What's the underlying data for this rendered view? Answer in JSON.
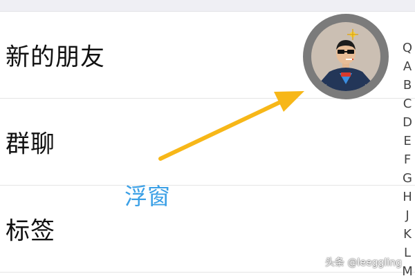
{
  "contacts_list": {
    "rows": [
      {
        "label": "新的朋友"
      },
      {
        "label": "群聊"
      },
      {
        "label": "标签"
      }
    ]
  },
  "floating_window": {
    "annotation": "浮窗",
    "avatar_icon": "cartoon-man-avatar-icon",
    "ring_color": "#7b7b7b"
  },
  "annotation_arrow": {
    "color": "#f7b718"
  },
  "index_bar": {
    "items": [
      "Q",
      "A",
      "B",
      "C",
      "D",
      "E",
      "F",
      "G",
      "H",
      "J",
      "K",
      "L",
      "M"
    ]
  },
  "watermark": {
    "text": "头条 @leeggling"
  }
}
